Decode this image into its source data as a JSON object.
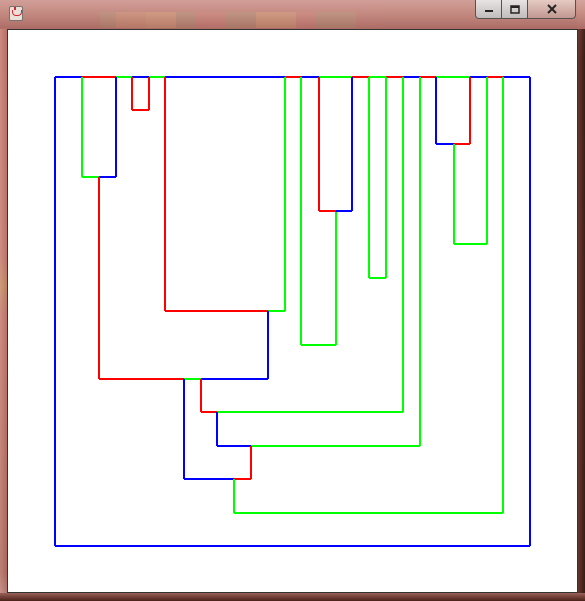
{
  "window": {
    "title": "",
    "buttons": {
      "minimize": "minimize",
      "maximize": "maximize",
      "close": "close"
    },
    "icon": "java-cup-icon"
  },
  "colors": {
    "blue": "#0000ff",
    "red": "#ff0000",
    "green": "#00ff00",
    "background": "#ffffff"
  },
  "drawing": {
    "description_shape": "nested rectilinear tree/dendrogram of colored segments",
    "segment_colors": [
      "blue",
      "red",
      "green"
    ]
  }
}
